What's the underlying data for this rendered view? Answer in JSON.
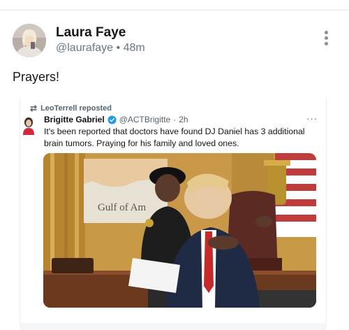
{
  "post": {
    "display_name": "Laura Faye",
    "handle": "@laurafaye",
    "separator": "•",
    "time": "48m",
    "text": "Prayers!"
  },
  "embedded_post": {
    "repost_icon": "repost-icon",
    "repost_label": "LeoTerrell reposted",
    "author_name": "Brigitte Gabriel",
    "verified_icon": "verified-badge-icon",
    "author_handle": "@ACTBrigitte",
    "separator": "·",
    "time": "2h",
    "more_label": "···",
    "text": "It's been reported that doctors have found DJ Daniel has 3 additional brain tumors. Praying for his family and loved ones.",
    "photo_sign_text": "Gulf of Am"
  },
  "colors": {
    "accent_blue": "#1d9bf0",
    "muted_text": "#657786"
  }
}
